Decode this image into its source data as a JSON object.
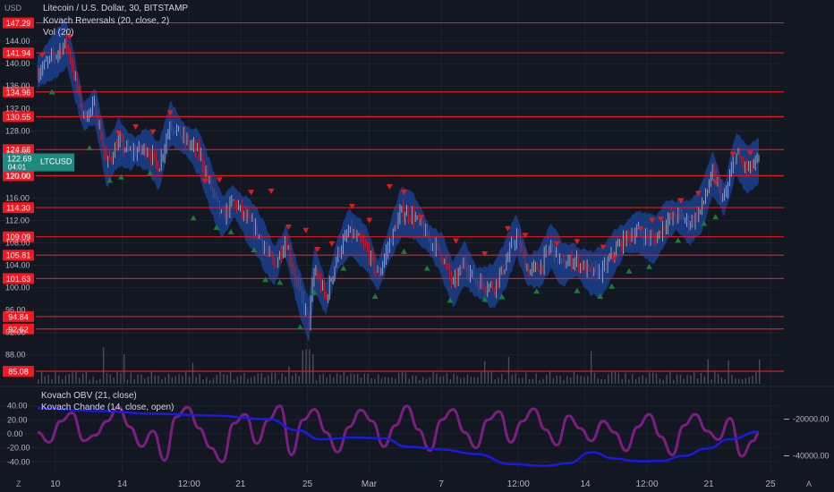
{
  "header": {
    "currency": "USD",
    "title": "Litecoin / U.S. Dollar, 30, BITSTAMP",
    "indicator_1": "Kovach Reversals (20, close, 2)",
    "indicator_2": "Vol (20)"
  },
  "lower_pane": {
    "indicator_1": "Kovach OBV (21, close)",
    "indicator_2": "Kovach Chande (14, close, open)"
  },
  "corner_left": "Z",
  "corner_right": "A",
  "colors": {
    "background": "#131722",
    "level_line": "#e0191e",
    "level_label": "#f7151f",
    "band": "#1b3f8f",
    "candle_up": "#b2b5be",
    "candle_down": "#e3191c",
    "marker_down": "#e3191c",
    "marker_up": "#1b7a3a",
    "chande": "#7b1e82",
    "obv": "#1a1ae6",
    "current_price": "#1f8a81",
    "axis_text": "#b2b5be",
    "grid": "#1e222d"
  },
  "chart_data": [
    {
      "type": "candlestick",
      "title": "Litecoin / U.S. Dollar, 30, BITSTAMP",
      "ylabel": "USD",
      "ylim": [
        83,
        148.5
      ],
      "y_ticks": [
        88,
        92,
        96,
        100,
        104,
        108,
        112,
        116,
        120,
        124,
        128,
        132,
        136,
        140,
        144
      ],
      "x_ticks": [
        "10",
        "14",
        "12:00",
        "21",
        "25",
        "Mar",
        "7",
        "12:00",
        "14",
        "12:00",
        "21",
        "25"
      ],
      "levels": [
        147.29,
        141.94,
        134.96,
        130.55,
        124.66,
        120.0,
        114.3,
        109.09,
        105.81,
        101.63,
        94.84,
        92.62,
        85.08
      ],
      "current_price": {
        "symbol": "LTCUSD",
        "price": "122.69",
        "countdown": "04:01"
      },
      "price_path": [
        [
          0,
          138.5
        ],
        [
          3,
          141.5
        ],
        [
          5,
          143.8
        ],
        [
          6,
          139.5
        ],
        [
          8,
          130.5
        ],
        [
          10,
          132.5
        ],
        [
          12,
          122
        ],
        [
          14,
          126
        ],
        [
          16,
          124.2
        ],
        [
          19,
          124.8
        ],
        [
          21,
          121.5
        ],
        [
          23,
          129.5
        ],
        [
          25,
          127
        ],
        [
          28,
          124
        ],
        [
          30,
          118
        ],
        [
          32,
          112.5
        ],
        [
          34,
          115.5
        ],
        [
          36,
          112.5
        ],
        [
          38,
          110
        ],
        [
          41,
          103.8
        ],
        [
          43,
          108.5
        ],
        [
          45,
          100.5
        ],
        [
          47,
          94
        ],
        [
          48,
          103.5
        ],
        [
          50,
          98
        ],
        [
          52,
          106
        ],
        [
          54,
          110
        ],
        [
          57,
          107
        ],
        [
          59,
          102
        ],
        [
          61,
          108
        ],
        [
          63,
          113.5
        ],
        [
          65,
          113
        ],
        [
          68,
          108.5
        ],
        [
          70,
          106
        ],
        [
          72,
          100.5
        ],
        [
          74,
          104.5
        ],
        [
          76,
          101
        ],
        [
          79,
          100.2
        ],
        [
          81,
          104
        ],
        [
          83,
          109.5
        ],
        [
          85,
          103
        ],
        [
          87,
          103.5
        ],
        [
          89,
          107.5
        ],
        [
          91,
          104
        ],
        [
          93,
          105
        ],
        [
          96,
          102.5
        ],
        [
          98,
          103
        ],
        [
          100,
          106.5
        ],
        [
          102,
          109
        ],
        [
          104,
          110
        ],
        [
          107,
          108.5
        ],
        [
          109,
          112
        ],
        [
          111,
          113
        ],
        [
          113,
          111.5
        ],
        [
          115,
          114
        ],
        [
          117,
          120.5
        ],
        [
          119,
          115.5
        ],
        [
          121,
          124
        ],
        [
          123,
          121
        ],
        [
          125,
          122.69
        ]
      ],
      "markers_down": [
        [
          0.8,
          141.5
        ],
        [
          5.6,
          144.8
        ],
        [
          14,
          127.6
        ],
        [
          17,
          128.7
        ],
        [
          20,
          127.8
        ],
        [
          23,
          131.2
        ],
        [
          29,
          119
        ],
        [
          31.5,
          119.2
        ],
        [
          37,
          117
        ],
        [
          40.5,
          117.2
        ],
        [
          43.5,
          110.8
        ],
        [
          46.5,
          110.2
        ],
        [
          48.5,
          106.8
        ],
        [
          51,
          107.8
        ],
        [
          54.5,
          114.5
        ],
        [
          57.5,
          112
        ],
        [
          61,
          118
        ],
        [
          63.5,
          117
        ],
        [
          66.5,
          112.5
        ],
        [
          72.5,
          108.3
        ],
        [
          77.5,
          106
        ],
        [
          81.5,
          110.5
        ],
        [
          84.5,
          109.3
        ],
        [
          90,
          107.8
        ],
        [
          93.5,
          108.2
        ],
        [
          98,
          107.2
        ],
        [
          100,
          105.3
        ],
        [
          104.5,
          110.5
        ],
        [
          106.5,
          112
        ],
        [
          108,
          112.2
        ],
        [
          111.5,
          115.5
        ],
        [
          114.5,
          116.8
        ],
        [
          117.5,
          118.8
        ],
        [
          120.5,
          123.8
        ],
        [
          123.5,
          124
        ]
      ],
      "markers_up": [
        [
          2.5,
          135
        ],
        [
          9,
          125
        ],
        [
          12.5,
          119.2
        ],
        [
          14.5,
          119.8
        ],
        [
          19.5,
          120.5
        ],
        [
          27,
          112.5
        ],
        [
          31,
          110.8
        ],
        [
          33.5,
          110
        ],
        [
          37.5,
          106.8
        ],
        [
          39.5,
          101.5
        ],
        [
          42,
          101
        ],
        [
          45.5,
          93
        ],
        [
          48,
          99.2
        ],
        [
          53,
          103.5
        ],
        [
          58.5,
          98.5
        ],
        [
          63.5,
          106.5
        ],
        [
          67.5,
          103.5
        ],
        [
          71.5,
          97.8
        ],
        [
          77.5,
          98
        ],
        [
          80.5,
          98.4
        ],
        [
          86.5,
          99.4
        ],
        [
          93.5,
          99.5
        ],
        [
          97.5,
          98.5
        ],
        [
          99.5,
          100.3
        ],
        [
          102.5,
          103
        ],
        [
          106,
          103.8
        ],
        [
          111,
          108.5
        ],
        [
          115.5,
          111.5
        ],
        [
          117.5,
          112.7
        ]
      ]
    },
    {
      "type": "line",
      "series": [
        {
          "name": "Kovach OBV (21, close)"
        },
        {
          "name": "Kovach Chande (14, close, open)"
        }
      ],
      "left_ticks": [
        "40.00",
        "20.00",
        "0.00",
        "-20.00",
        "-40.00"
      ],
      "left_range": [
        -55,
        55
      ],
      "right_ticks": [
        "-20000.00",
        "-40000.00"
      ],
      "right_range": [
        -49000,
        -7000
      ],
      "obv_path": [
        [
          0,
          -14000
        ],
        [
          10,
          -15500
        ],
        [
          20,
          -17000
        ],
        [
          30,
          -18000
        ],
        [
          40,
          -20000
        ],
        [
          45,
          -26000
        ],
        [
          49,
          -31000
        ],
        [
          55,
          -30000
        ],
        [
          60,
          -30500
        ],
        [
          64,
          -35000
        ],
        [
          70,
          -36500
        ],
        [
          76,
          -39000
        ],
        [
          82,
          -44500
        ],
        [
          88,
          -45500
        ],
        [
          92,
          -44000
        ],
        [
          96,
          -38000
        ],
        [
          100,
          -41500
        ],
        [
          104,
          -43000
        ],
        [
          108,
          -42800
        ],
        [
          112,
          -40000
        ],
        [
          116,
          -36000
        ],
        [
          120,
          -31000
        ],
        [
          125,
          -26800
        ]
      ],
      "chande_path": [
        [
          0,
          2
        ],
        [
          2,
          -12
        ],
        [
          4,
          18
        ],
        [
          6,
          30
        ],
        [
          8,
          -10
        ],
        [
          10,
          -2
        ],
        [
          12,
          18
        ],
        [
          14,
          38
        ],
        [
          16,
          10
        ],
        [
          18,
          -18
        ],
        [
          20,
          4
        ],
        [
          22,
          -38
        ],
        [
          24,
          24
        ],
        [
          26,
          38
        ],
        [
          28,
          8
        ],
        [
          30,
          -20
        ],
        [
          32,
          -40
        ],
        [
          34,
          15
        ],
        [
          36,
          28
        ],
        [
          38,
          -14
        ],
        [
          40,
          20
        ],
        [
          42,
          40
        ],
        [
          44,
          -30
        ],
        [
          46,
          20
        ],
        [
          48,
          35
        ],
        [
          50,
          2
        ],
        [
          52,
          -26
        ],
        [
          54,
          10
        ],
        [
          56,
          34
        ],
        [
          58,
          18
        ],
        [
          60,
          -18
        ],
        [
          62,
          12
        ],
        [
          64,
          40
        ],
        [
          66,
          6
        ],
        [
          68,
          -24
        ],
        [
          70,
          20
        ],
        [
          72,
          35
        ],
        [
          74,
          2
        ],
        [
          76,
          -20
        ],
        [
          78,
          20
        ],
        [
          80,
          32
        ],
        [
          82,
          -12
        ],
        [
          84,
          18
        ],
        [
          86,
          36
        ],
        [
          88,
          6
        ],
        [
          90,
          -16
        ],
        [
          92,
          26
        ],
        [
          94,
          8
        ],
        [
          96,
          -10
        ],
        [
          98,
          18
        ],
        [
          100,
          2
        ],
        [
          102,
          -24
        ],
        [
          104,
          10
        ],
        [
          106,
          28
        ],
        [
          108,
          -4
        ],
        [
          110,
          -30
        ],
        [
          112,
          12
        ],
        [
          114,
          28
        ],
        [
          116,
          4
        ],
        [
          118,
          -8
        ],
        [
          120,
          22
        ],
        [
          122,
          -32
        ],
        [
          124,
          -10
        ],
        [
          125,
          1
        ]
      ]
    }
  ]
}
